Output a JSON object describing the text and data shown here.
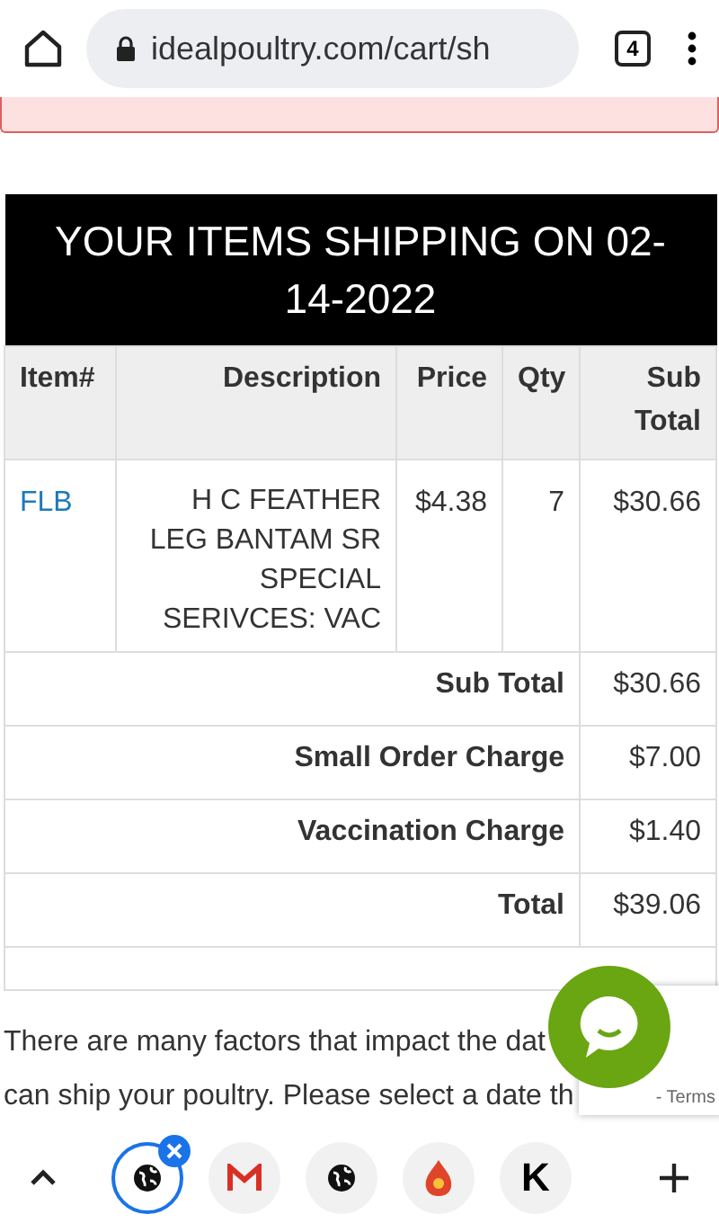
{
  "browser": {
    "url": "idealpoultry.com/cart/sh",
    "tab_count": "4"
  },
  "table": {
    "title": "YOUR ITEMS SHIPPING ON 02-14-2022",
    "columns": [
      "Item#",
      "Description",
      "Price",
      "Qty",
      "Sub Total"
    ],
    "rows": [
      {
        "item": "FLB",
        "description": "H C FEATHER LEG BANTAM SR SPECIAL SERIVCES: VAC",
        "price": "$4.38",
        "qty": "7",
        "subtotal": "$30.66"
      }
    ],
    "summary": [
      {
        "label": "Sub Total",
        "value": "$30.66"
      },
      {
        "label": "Small Order Charge",
        "value": "$7.00"
      },
      {
        "label": "Vaccination Charge",
        "value": "$1.40"
      },
      {
        "label": "Total",
        "value": "$39.06"
      }
    ]
  },
  "paragraph": [
    "There are many factors that impact the dat",
    "can ship your poultry. Please select a date th"
  ],
  "recaptcha": {
    "text": "- Terms"
  },
  "bottom_tabs": [
    {
      "kind": "globe",
      "selected": true
    },
    {
      "kind": "mail",
      "selected": false
    },
    {
      "kind": "globe",
      "selected": false
    },
    {
      "kind": "flame",
      "selected": false
    },
    {
      "kind": "k",
      "selected": false
    }
  ],
  "bottom_k_letter": "K"
}
